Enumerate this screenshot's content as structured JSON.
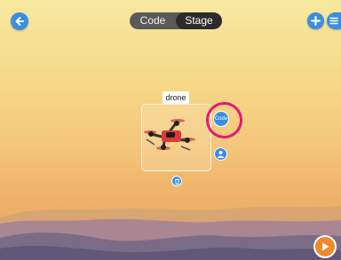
{
  "header": {
    "tabs": [
      {
        "label": "Code",
        "active": false
      },
      {
        "label": "Stage",
        "active": true
      }
    ]
  },
  "icons": {
    "back": "arrow-left-icon",
    "add": "plus-icon",
    "menu": "hamburger-menu-icon",
    "costume": "person-icon",
    "delete": "trash-icon",
    "play": "play-icon"
  },
  "sprite": {
    "name": "drone",
    "code_button_label": "Code"
  },
  "colors": {
    "accent_blue": "#3b8de0",
    "highlight_ring": "#e11b78",
    "play_orange": "#ef8a2b",
    "sky_top": "#f7e9a0",
    "sky_bottom": "#e8a15e",
    "mountain_far": "#9c7e8c",
    "mountain_near": "#5f5878"
  }
}
